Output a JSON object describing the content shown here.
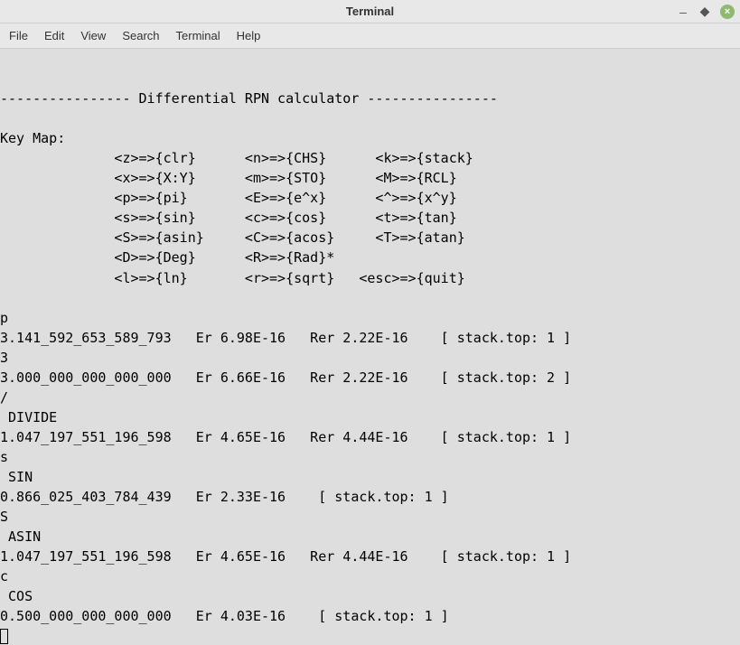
{
  "window": {
    "title": "Terminal"
  },
  "menu": {
    "items": [
      "File",
      "Edit",
      "View",
      "Search",
      "Terminal",
      "Help"
    ]
  },
  "terminal": {
    "lines": [
      "",
      "---------------- Differential RPN calculator ----------------",
      "",
      "Key Map:",
      "              <z>=>{clr}      <n>=>{CHS}      <k>=>{stack}",
      "              <x>=>{X:Y}      <m>=>{STO}      <M>=>{RCL}",
      "              <p>=>{pi}       <E>=>{e^x}      <^>=>{x^y}",
      "              <s>=>{sin}      <c>=>{cos}      <t>=>{tan}",
      "              <S>=>{asin}     <C>=>{acos}     <T>=>{atan}",
      "              <D>=>{Deg}      <R>=>{Rad}*",
      "              <l>=>{ln}       <r>=>{sqrt}   <esc>=>{quit}",
      "",
      "p",
      "3.141_592_653_589_793   Er 6.98E-16   Rer 2.22E-16    [ stack.top: 1 ]",
      "3",
      "3.000_000_000_000_000   Er 6.66E-16   Rer 2.22E-16    [ stack.top: 2 ]",
      "/",
      " DIVIDE",
      "1.047_197_551_196_598   Er 4.65E-16   Rer 4.44E-16    [ stack.top: 1 ]",
      "s",
      " SIN",
      "0.866_025_403_784_439   Er 2.33E-16    [ stack.top: 1 ]",
      "S",
      " ASIN",
      "1.047_197_551_196_598   Er 4.65E-16   Rer 4.44E-16    [ stack.top: 1 ]",
      "c",
      " COS",
      "0.500_000_000_000_000   Er 4.03E-16    [ stack.top: 1 ]"
    ]
  }
}
